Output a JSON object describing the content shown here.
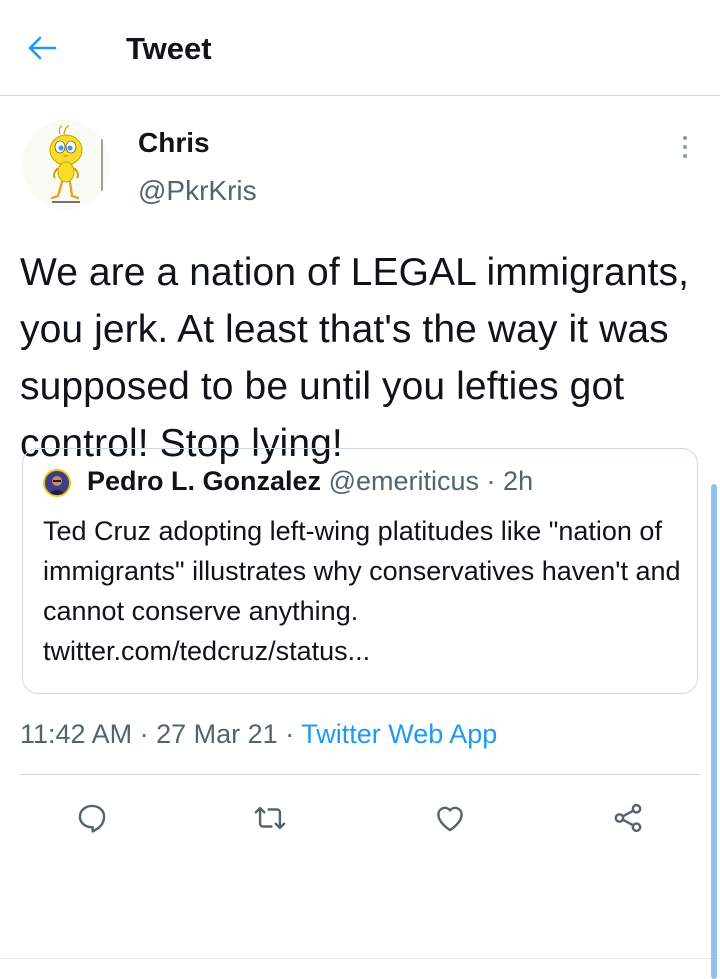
{
  "header": {
    "title": "Tweet",
    "back_icon": "arrow-left-icon"
  },
  "tweet": {
    "author_name": "Chris",
    "author_handle": "@PkrKris",
    "text": "We are a nation of LEGAL immigrants, you jerk. At least that's the way it was supposed to be until you lefties got control! Stop lying!",
    "time": "11:42 AM",
    "date": "27 Mar 21",
    "source": "Twitter Web App",
    "separator": "·"
  },
  "quoted_tweet": {
    "author_name": "Pedro L. Gonzalez",
    "author_handle": "@emeriticus",
    "age": "2h",
    "text": "Ted Cruz adopting left-wing platitudes like \"nation of immigrants\" illustrates why conservatives haven't and cannot conserve anything. twitter.com/tedcruz/status..."
  },
  "actions": [
    {
      "name": "reply",
      "icon": "reply-icon"
    },
    {
      "name": "retweet",
      "icon": "retweet-icon"
    },
    {
      "name": "like",
      "icon": "heart-icon"
    },
    {
      "name": "share",
      "icon": "share-icon"
    }
  ],
  "colors": {
    "accent": "#1d9bf0",
    "secondary_text": "#536471",
    "border": "#cfd9de"
  }
}
